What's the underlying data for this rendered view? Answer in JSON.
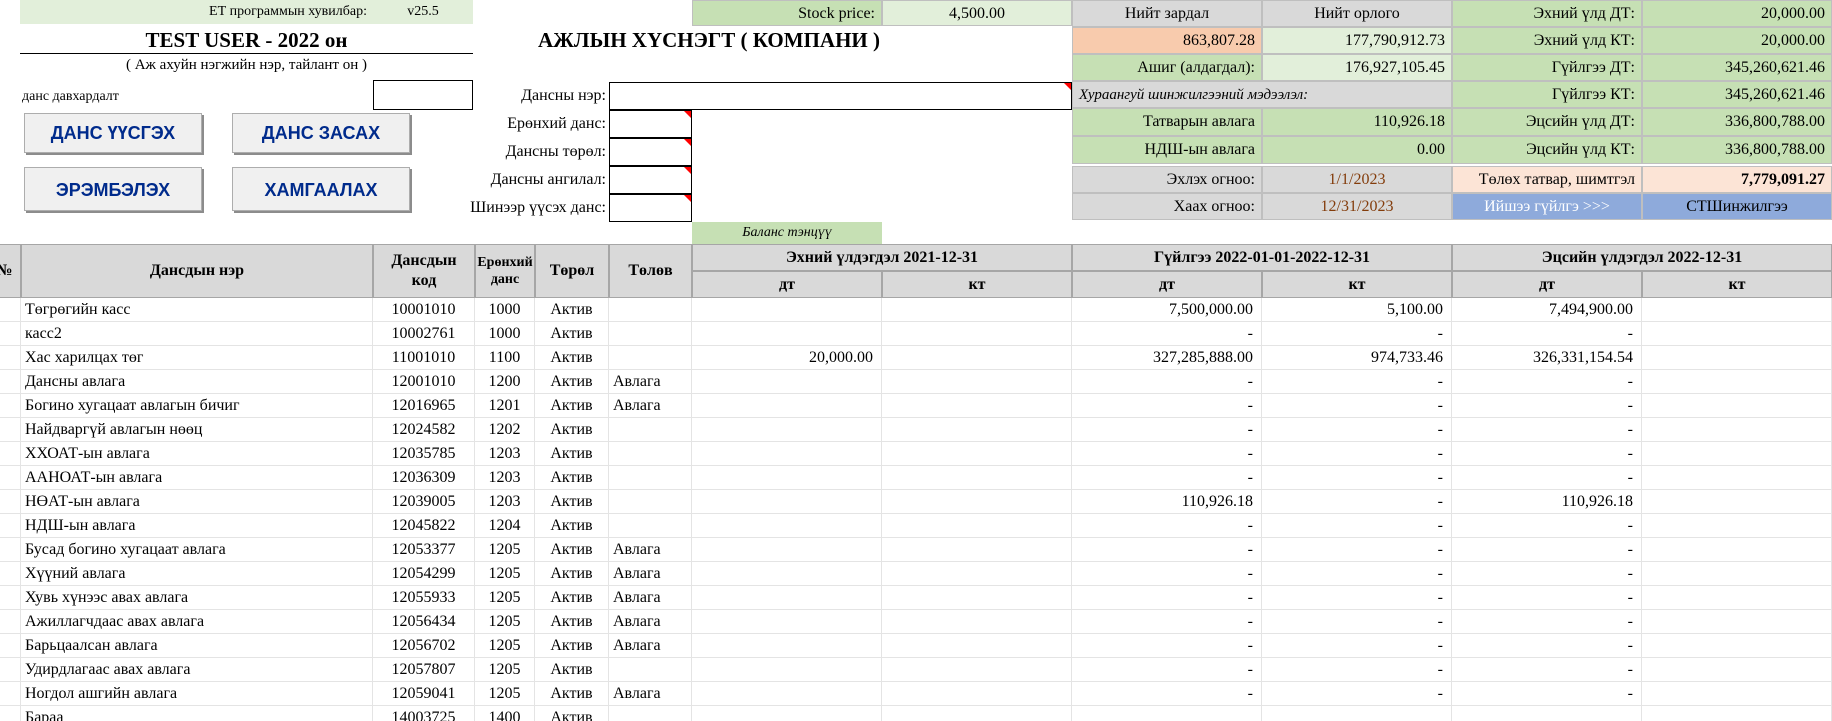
{
  "version": {
    "label": "ЕТ программын хувилбар:",
    "value": "v25.5"
  },
  "company": {
    "title": "TEST USER - 2022 он",
    "subtitle": "( Аж ахуйн нэгжийн нэр, тайлант он )"
  },
  "sheet_title": "АЖЛЫН ХҮСНЭГТ ( КОМПАНИ )",
  "account_repeat_label": "данс давхардалт",
  "buttons": {
    "create": "ДАНС ҮҮСГЭХ",
    "edit": "ДАНС ЗАСАХ",
    "sort": "ЭРЭМБЭЛЭХ",
    "protect": "ХАМГААЛАХ"
  },
  "form": {
    "account_name": "Дансны нэр:",
    "general_account": "Ерөнхий данс:",
    "account_type": "Дансны төрөл:",
    "account_category": "Дансны ангилал:",
    "new_account": "Шинээр үүсэх данс:"
  },
  "stock": {
    "label": "Stock price:",
    "value": "4,500.00"
  },
  "balance_label": "Баланс тэнцүү",
  "summary": {
    "total_expense_label": "Нийт зардал",
    "total_income_label": "Нийт орлого",
    "total_expense": "863,807.28",
    "total_income": "177,790,912.73",
    "profit_label": "Ашиг (алдагдал):",
    "profit": "176,927,105.45",
    "analysis_label": "Хураангуй шинжилгээний мэдээлэл:",
    "tax_recv_label": "Татварын авлага",
    "tax_recv": "110,926.18",
    "ndsh_recv_label": "НДШ-ын авлага",
    "ndsh_recv": "0.00",
    "start_date_label": "Эхлэх огноо:",
    "start_date": "1/1/2023",
    "end_date_label": "Хаах огноо:",
    "end_date": "12/31/2023",
    "open_dt_label": "Эхний үлд ДТ:",
    "open_dt": "20,000.00",
    "open_kt_label": "Эхний үлд КТ:",
    "open_kt": "20,000.00",
    "tr_dt_label": "Гүйлгээ ДТ:",
    "tr_dt": "345,260,621.46",
    "tr_kt_label": "Гүйлгээ КТ:",
    "tr_kt": "345,260,621.46",
    "close_dt_label": "Эцсийн үлд ДТ:",
    "close_dt": "336,800,788.00",
    "close_kt_label": "Эцсийн үлд КТ:",
    "close_kt": "336,800,788.00",
    "tax_pay_label": "Төлөх татвар, шимтгэл",
    "tax_pay": "7,779,091.27",
    "transactions_link": "Ийшээ гүйлгэ >>>",
    "analysis_link": "СТШинжилгээ"
  },
  "table": {
    "headers": {
      "num": "№",
      "name": "Дансдын нэр",
      "code": "Дансдын код",
      "general": "Ерөнхий данс",
      "type": "Төрөл",
      "status": "Төлөв",
      "opening": "Эхний үлдэгдэл 2021-12-31",
      "transactions": "Гүйлгээ 2022-01-01-2022-12-31",
      "closing": "Эцсийн үлдэгдэл 2022-12-31",
      "dt": "дт",
      "kt": "кт"
    },
    "rows": [
      {
        "name": "Төгрөгийн касс",
        "code": "10001010",
        "gen": "1000",
        "type": "Актив",
        "status": "",
        "odt": "",
        "okt": "",
        "tdt": "7,500,000.00",
        "tkt": "5,100.00",
        "cdt": "7,494,900.00",
        "ckt": ""
      },
      {
        "name": "касс2",
        "code": "10002761",
        "gen": "1000",
        "type": "Актив",
        "status": "",
        "odt": "",
        "okt": "",
        "tdt": "-",
        "tkt": "-",
        "cdt": "-",
        "ckt": ""
      },
      {
        "name": "Хас харилцах төг",
        "code": "11001010",
        "gen": "1100",
        "type": "Актив",
        "status": "",
        "odt": "20,000.00",
        "okt": "",
        "tdt": "327,285,888.00",
        "tkt": "974,733.46",
        "cdt": "326,331,154.54",
        "ckt": ""
      },
      {
        "name": "Дансны авлага",
        "code": "12001010",
        "gen": "1200",
        "type": "Актив",
        "status": "Авлага",
        "odt": "",
        "okt": "",
        "tdt": "-",
        "tkt": "-",
        "cdt": "-",
        "ckt": ""
      },
      {
        "name": "Богино хугацаат авлагын бичиг",
        "code": "12016965",
        "gen": "1201",
        "type": "Актив",
        "status": "Авлага",
        "odt": "",
        "okt": "",
        "tdt": "-",
        "tkt": "-",
        "cdt": "-",
        "ckt": ""
      },
      {
        "name": "Найдваргүй авлагын нөөц",
        "code": "12024582",
        "gen": "1202",
        "type": "Актив",
        "status": "",
        "odt": "",
        "okt": "",
        "tdt": "-",
        "tkt": "-",
        "cdt": "-",
        "ckt": ""
      },
      {
        "name": "ХХОАТ-ын авлага",
        "code": "12035785",
        "gen": "1203",
        "type": "Актив",
        "status": "",
        "odt": "",
        "okt": "",
        "tdt": "-",
        "tkt": "-",
        "cdt": "-",
        "ckt": ""
      },
      {
        "name": "ААНОАТ-ын авлага",
        "code": "12036309",
        "gen": "1203",
        "type": "Актив",
        "status": "",
        "odt": "",
        "okt": "",
        "tdt": "-",
        "tkt": "-",
        "cdt": "-",
        "ckt": ""
      },
      {
        "name": "НӨАТ-ын авлага",
        "code": "12039005",
        "gen": "1203",
        "type": "Актив",
        "status": "",
        "odt": "",
        "okt": "",
        "tdt": "110,926.18",
        "tkt": "-",
        "cdt": "110,926.18",
        "ckt": ""
      },
      {
        "name": "НДШ-ын авлага",
        "code": "12045822",
        "gen": "1204",
        "type": "Актив",
        "status": "",
        "odt": "",
        "okt": "",
        "tdt": "-",
        "tkt": "-",
        "cdt": "-",
        "ckt": ""
      },
      {
        "name": "Бусад богино хугацаат авлага",
        "code": "12053377",
        "gen": "1205",
        "type": "Актив",
        "status": "Авлага",
        "odt": "",
        "okt": "",
        "tdt": "-",
        "tkt": "-",
        "cdt": "-",
        "ckt": ""
      },
      {
        "name": "Хүүний авлага",
        "code": "12054299",
        "gen": "1205",
        "type": "Актив",
        "status": "Авлага",
        "odt": "",
        "okt": "",
        "tdt": "-",
        "tkt": "-",
        "cdt": "-",
        "ckt": ""
      },
      {
        "name": "Хувь хүнээс авах авлага",
        "code": "12055933",
        "gen": "1205",
        "type": "Актив",
        "status": "Авлага",
        "odt": "",
        "okt": "",
        "tdt": "-",
        "tkt": "-",
        "cdt": "-",
        "ckt": ""
      },
      {
        "name": "Ажиллагчдаас авах авлага",
        "code": "12056434",
        "gen": "1205",
        "type": "Актив",
        "status": "Авлага",
        "odt": "",
        "okt": "",
        "tdt": "-",
        "tkt": "-",
        "cdt": "-",
        "ckt": ""
      },
      {
        "name": "Барьцаалсан авлага",
        "code": "12056702",
        "gen": "1205",
        "type": "Актив",
        "status": "Авлага",
        "odt": "",
        "okt": "",
        "tdt": "-",
        "tkt": "-",
        "cdt": "-",
        "ckt": ""
      },
      {
        "name": "Удирдлагаас авах авлага",
        "code": "12057807",
        "gen": "1205",
        "type": "Актив",
        "status": "",
        "odt": "",
        "okt": "",
        "tdt": "-",
        "tkt": "-",
        "cdt": "-",
        "ckt": ""
      },
      {
        "name": "Ногдол ашгийн авлага",
        "code": "12059041",
        "gen": "1205",
        "type": "Актив",
        "status": "Авлага",
        "odt": "",
        "okt": "",
        "tdt": "-",
        "tkt": "-",
        "cdt": "-",
        "ckt": ""
      },
      {
        "name": "Бараа",
        "code": "14003725",
        "gen": "1400",
        "type": "Актив",
        "status": "",
        "odt": "",
        "okt": "",
        "tdt": "",
        "tkt": "",
        "cdt": "",
        "ckt": ""
      }
    ]
  }
}
